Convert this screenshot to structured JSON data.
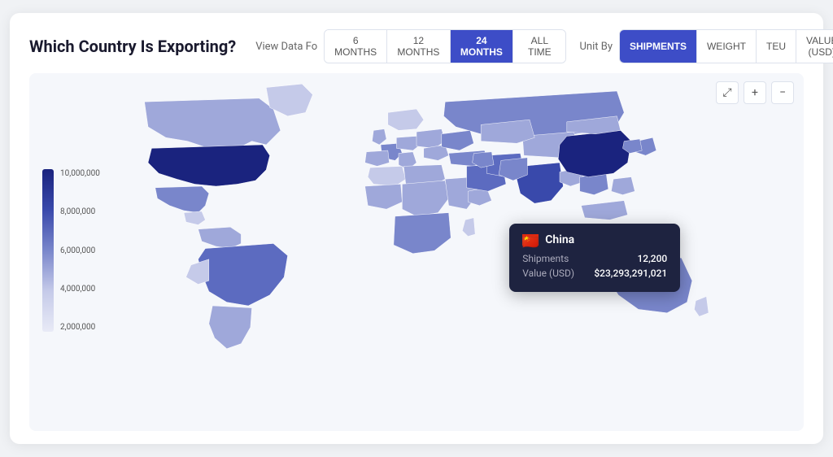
{
  "header": {
    "title": "Which Country Is Exporting?",
    "view_data_label": "View Data Fo",
    "time_buttons": [
      {
        "label": "6 MONTHS",
        "active": false
      },
      {
        "label": "12 MONTHS",
        "active": false
      },
      {
        "label": "24 MONTHS",
        "active": true
      },
      {
        "label": "ALL TIME",
        "active": false
      }
    ],
    "unit_label": "Unit By",
    "unit_buttons": [
      {
        "label": "SHIPMENTS",
        "active": true
      },
      {
        "label": "WEIGHT",
        "active": false
      },
      {
        "label": "TEU",
        "active": false
      },
      {
        "label": "VALUE (USD)",
        "active": false
      }
    ]
  },
  "map_controls": {
    "expand_label": "⤢",
    "zoom_in_label": "⊕",
    "zoom_out_label": "⊖"
  },
  "legend": {
    "values": [
      "10,000,000",
      "8,000,000",
      "6,000,000",
      "4,000,000",
      "2,000,000"
    ]
  },
  "tooltip": {
    "country": "China",
    "flag": "🇨🇳",
    "shipments_label": "Shipments",
    "shipments_value": "12,200",
    "value_label": "Value (USD)",
    "value_value": "$23,293,291,021"
  }
}
